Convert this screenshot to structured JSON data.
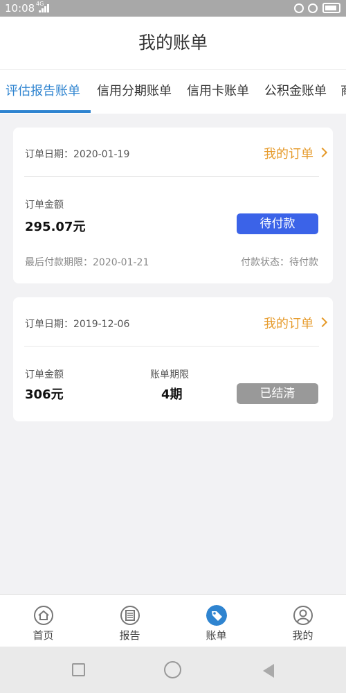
{
  "status_bar": {
    "time": "10:08",
    "network": "4G"
  },
  "header": {
    "title": "我的账单"
  },
  "tabs": [
    {
      "label": "评估报告账单"
    },
    {
      "label": "信用分期账单"
    },
    {
      "label": "信用卡账单"
    },
    {
      "label": "公积金账单"
    },
    {
      "label": "商"
    }
  ],
  "orders": [
    {
      "date": "订单日期：2020-01-19",
      "my_order": "我的订单",
      "amount_label": "订单金额",
      "amount": "295.07元",
      "button": "待付款",
      "deadline": "最后付款期限：2020-01-21",
      "pay_status": "付款状态：待付款"
    },
    {
      "date": "订单日期：2019-12-06",
      "my_order": "我的订单",
      "amount_label": "订单金额",
      "amount": "306元",
      "period_label": "账单期限",
      "period": "4期",
      "button": "已结清"
    }
  ],
  "bottom_nav": [
    {
      "label": "首页",
      "icon": "home-icon"
    },
    {
      "label": "报告",
      "icon": "report-icon"
    },
    {
      "label": "账单",
      "icon": "bill-tag-icon"
    },
    {
      "label": "我的",
      "icon": "user-icon"
    }
  ],
  "colors": {
    "accent": "#2f84d0",
    "orange": "#e69a2a",
    "pay_button": "#3b63e8",
    "done_button": "#999999"
  }
}
